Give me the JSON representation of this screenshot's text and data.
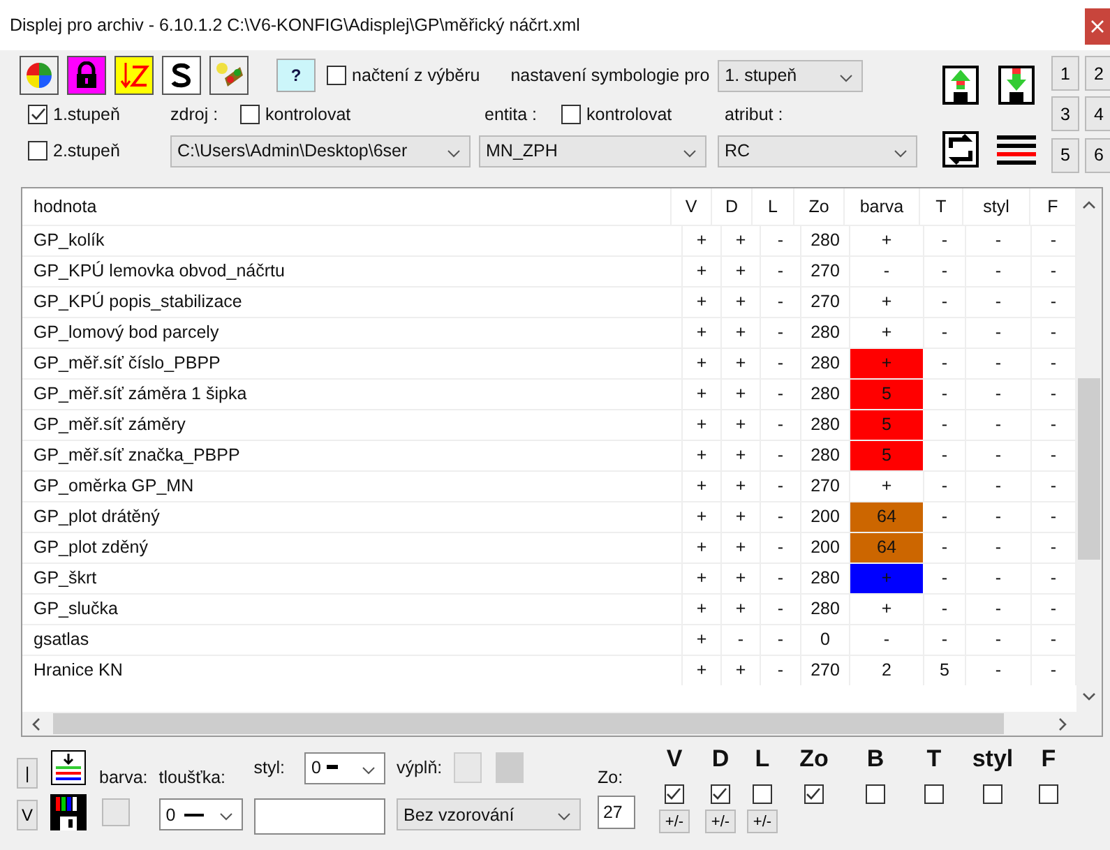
{
  "window": {
    "title": "Displej pro archiv - 6.10.1.2 C:\\V6-KONFIG\\Adisplej\\GP\\měřický náčrt.xml"
  },
  "toolbar": {
    "help": "?",
    "nacteni": {
      "label": "načtení z výběru",
      "checked": false
    },
    "symbologie_label": "nastavení symbologie pro",
    "symbologie_value": "1. stupeň",
    "stupne": [
      {
        "label": "1.stupeň",
        "checked": true
      },
      {
        "label": "2.stupeň",
        "checked": false
      }
    ],
    "zdroj": {
      "label": "zdroj :",
      "check_label": "kontrolovat",
      "checked": false,
      "value": "C:\\Users\\Admin\\Desktop\\6ser"
    },
    "entita": {
      "label": "entita :",
      "check_label": "kontrolovat",
      "checked": false,
      "value": "MN_ZPH"
    },
    "atribut": {
      "label": "atribut :",
      "value": "RC"
    },
    "number_buttons": [
      "1",
      "2",
      "3",
      "4",
      "5",
      "6"
    ]
  },
  "table": {
    "columns": [
      "hodnota",
      "V",
      "D",
      "L",
      "Zo",
      "barva",
      "T",
      "styl",
      "F"
    ],
    "rows": [
      {
        "cells": [
          "GP_kolík",
          "+",
          "+",
          "-",
          "280",
          "+",
          "-",
          "-",
          "-"
        ]
      },
      {
        "cells": [
          "GP_KPÚ lemovka obvod_náčrtu",
          "+",
          "+",
          "-",
          "270",
          "-",
          "-",
          "-",
          "-"
        ]
      },
      {
        "cells": [
          "GP_KPÚ popis_stabilizace",
          "+",
          "+",
          "-",
          "270",
          "+",
          "-",
          "-",
          "-"
        ]
      },
      {
        "cells": [
          "GP_lomový bod parcely",
          "+",
          "+",
          "-",
          "280",
          "+",
          "-",
          "-",
          "-"
        ]
      },
      {
        "cells": [
          "GP_měř.síť číslo_PBPP",
          "+",
          "+",
          "-",
          "280",
          "+",
          "-",
          "-",
          "-"
        ],
        "color": "#ff0000"
      },
      {
        "cells": [
          "GP_měř.síť záměra 1 šipka",
          "+",
          "+",
          "-",
          "280",
          "5",
          "-",
          "-",
          "-"
        ],
        "color": "#ff0000"
      },
      {
        "cells": [
          "GP_měř.síť záměry",
          "+",
          "+",
          "-",
          "280",
          "5",
          "-",
          "-",
          "-"
        ],
        "color": "#ff0000"
      },
      {
        "cells": [
          "GP_měř.síť značka_PBPP",
          "+",
          "+",
          "-",
          "280",
          "5",
          "-",
          "-",
          "-"
        ],
        "color": "#ff0000"
      },
      {
        "cells": [
          "GP_oměrka GP_MN",
          "+",
          "+",
          "-",
          "270",
          "+",
          "-",
          "-",
          "-"
        ]
      },
      {
        "cells": [
          "GP_plot drátěný",
          "+",
          "+",
          "-",
          "200",
          "64",
          "-",
          "-",
          "-"
        ],
        "color": "#cc6600"
      },
      {
        "cells": [
          "GP_plot zděný",
          "+",
          "+",
          "-",
          "200",
          "64",
          "-",
          "-",
          "-"
        ],
        "color": "#cc6600"
      },
      {
        "cells": [
          "GP_škrt",
          "+",
          "+",
          "-",
          "280",
          "+",
          "-",
          "-",
          "-"
        ],
        "color": "#0000ff"
      },
      {
        "cells": [
          "GP_slučka",
          "+",
          "+",
          "-",
          "280",
          "+",
          "-",
          "-",
          "-"
        ]
      },
      {
        "cells": [
          "gsatlas",
          "+",
          "-",
          "-",
          "0",
          "-",
          "-",
          "-",
          "-"
        ]
      },
      {
        "cells": [
          "Hranice KN",
          "+",
          "+",
          "-",
          "270",
          "2",
          "5",
          "-",
          "-"
        ]
      }
    ]
  },
  "bottom": {
    "line_button": "|",
    "v_button": "V",
    "barva_label": "barva:",
    "tloustka_label": "tloušťka:",
    "tloustka_value": "0",
    "styl_label": "styl:",
    "styl_value": "0",
    "vypln_label": "výplň:",
    "vypln_value": "Bez vzorování",
    "zo_label": "Zo:",
    "zo_value": "27",
    "flags": [
      {
        "label": "V",
        "checked": true,
        "toggle": "+/-"
      },
      {
        "label": "D",
        "checked": true,
        "toggle": "+/-"
      },
      {
        "label": "L",
        "checked": false,
        "toggle": "+/-"
      },
      {
        "label": "Zo",
        "checked": true
      },
      {
        "label": "B",
        "checked": false
      },
      {
        "label": "T",
        "checked": false
      },
      {
        "label": "styl",
        "checked": false
      },
      {
        "label": "F",
        "checked": false
      }
    ]
  }
}
